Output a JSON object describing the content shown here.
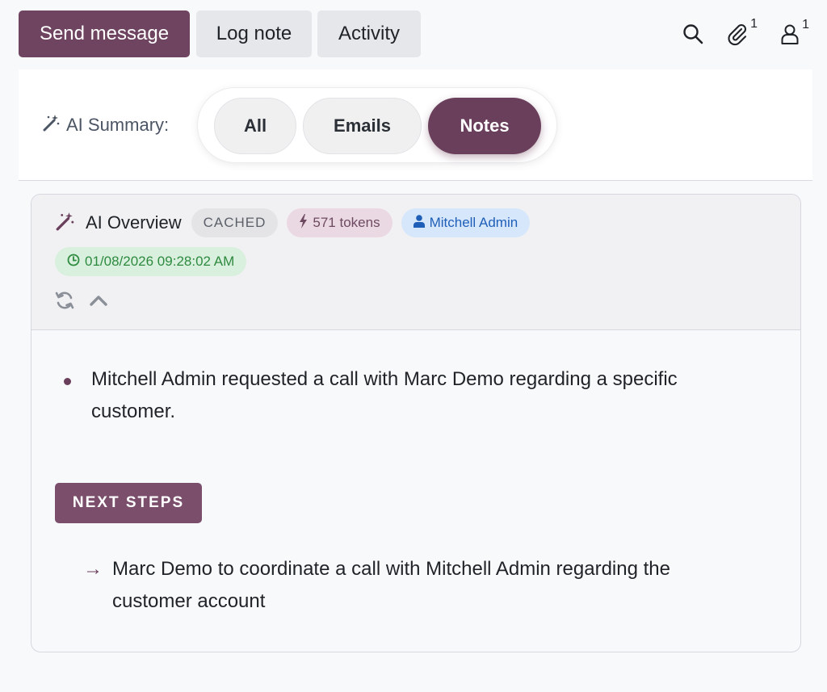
{
  "toolbar": {
    "send_message": "Send message",
    "log_note": "Log note",
    "activity": "Activity",
    "attachments_count": "1",
    "followers_count": "1"
  },
  "summary": {
    "label": "AI Summary:",
    "filters": [
      {
        "label": "All",
        "active": false
      },
      {
        "label": "Emails",
        "active": false
      },
      {
        "label": "Notes",
        "active": true
      }
    ]
  },
  "overview": {
    "title": "AI Overview",
    "badges": {
      "cached": "CACHED",
      "tokens": "571 tokens",
      "user": "Mitchell Admin",
      "timestamp": "01/08/2026 09:28:02 AM"
    },
    "bullets": [
      "Mitchell Admin requested a call with Marc Demo regarding a specific customer."
    ],
    "next_steps_label": "NEXT STEPS",
    "next_steps": [
      "Marc Demo to coordinate a call with Mitchell Admin regarding the customer account"
    ]
  },
  "colors": {
    "primary": "#6f4460",
    "active_filter": "#6a3f5c",
    "tokens_badge_bg": "#ead9e3",
    "user_badge_bg": "#d6e6fb",
    "time_badge_bg": "#d9f0de"
  },
  "icons": [
    "search-icon",
    "paperclip-icon",
    "user-icon",
    "magic-wand-icon",
    "bolt-icon",
    "clock-icon",
    "refresh-icon",
    "chevron-up-icon",
    "arrow-right-icon"
  ]
}
